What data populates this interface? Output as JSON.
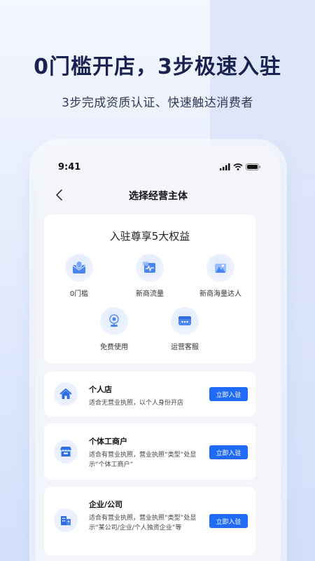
{
  "promo": {
    "headline": "0门槛开店，3步极速入驻",
    "subline": "3步完成资质认证、快速触达消费者"
  },
  "status_bar": {
    "time": "9:41"
  },
  "nav": {
    "title": "选择经营主体",
    "back_icon": "chevron-left-icon"
  },
  "benefits": {
    "title": "入驻尊享5大权益",
    "items": [
      {
        "label": "0门槛",
        "icon": "envelope-shield-icon"
      },
      {
        "label": "新商流量",
        "icon": "pulse-chart-icon"
      },
      {
        "label": "新商海量达人",
        "icon": "mountain-people-icon"
      },
      {
        "label": "免费使用",
        "icon": "camera-stand-icon"
      },
      {
        "label": "运营客服",
        "icon": "chat-bubble-icon"
      }
    ]
  },
  "entities": [
    {
      "name": "个人店",
      "desc": "适合无营业执照，以个人身份开店",
      "button": "立即入驻",
      "icon": "house-icon"
    },
    {
      "name": "个体工商户",
      "desc": "适合有营业执照，营业执照“类型”处显示“个体工商户”",
      "button": "立即入驻",
      "icon": "storefront-icon"
    },
    {
      "name": "企业/公司",
      "desc": "适合有营业执照，营业执照“类型”处显示“某公司/企业/个人独资企业”等",
      "button": "立即入驻",
      "icon": "building-icon"
    }
  ],
  "colors": {
    "accent": "#1f6bf5",
    "headline": "#1a2350"
  }
}
